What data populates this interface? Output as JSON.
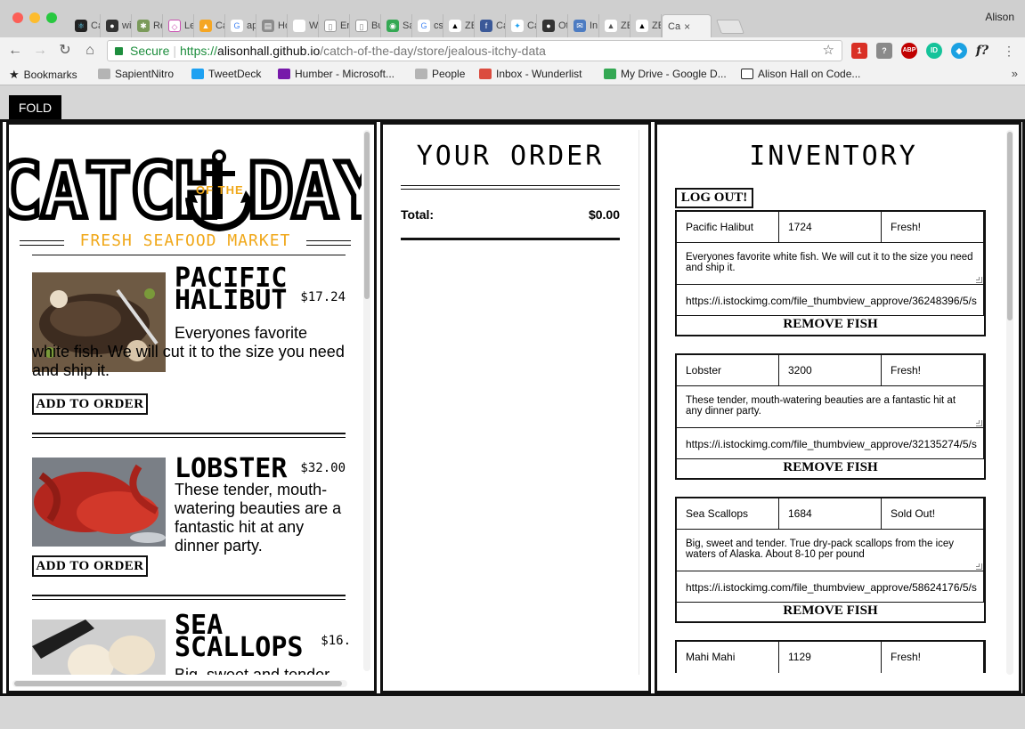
{
  "browser": {
    "profile": "Alison",
    "tabs": [
      {
        "label": "Ca",
        "icon": "react-icon",
        "color": "#222222"
      },
      {
        "label": "wi",
        "icon": "github-icon",
        "color": "#333333"
      },
      {
        "label": "Re",
        "icon": "react-icon",
        "color": "#7a9a5a"
      },
      {
        "label": "Le",
        "icon": "graphql-icon",
        "color": "#c94fb0"
      },
      {
        "label": "Ca",
        "icon": "firebase-icon",
        "color": "#f5a623"
      },
      {
        "label": "ap",
        "icon": "google-icon",
        "color": "#4285f4"
      },
      {
        "label": "Ho",
        "icon": "page-icon",
        "color": "#8c8c8c"
      },
      {
        "label": "W",
        "icon": "apple-icon",
        "color": "#888888"
      },
      {
        "label": "Er",
        "icon": "document-icon",
        "color": "#9a9a9a"
      },
      {
        "label": "Bu",
        "icon": "document-icon",
        "color": "#9a9a9a"
      },
      {
        "label": "Sa",
        "icon": "maps-icon",
        "color": "#34a853"
      },
      {
        "label": "cs",
        "icon": "google-icon",
        "color": "#4285f4"
      },
      {
        "label": "ZE",
        "icon": "zeit-icon",
        "color": "#000000"
      },
      {
        "label": "Ca",
        "icon": "facebook-icon",
        "color": "#3b5998"
      },
      {
        "label": "Ca",
        "icon": "twitter-icon",
        "color": "#1da1f2"
      },
      {
        "label": "Ot",
        "icon": "github-icon",
        "color": "#333333"
      },
      {
        "label": "In",
        "icon": "inbox-icon",
        "color": "#4d7cc2"
      },
      {
        "label": "ZE",
        "icon": "zeit-icon",
        "color": "#555555"
      },
      {
        "label": "ZE",
        "icon": "zeit-icon",
        "color": "#000000"
      }
    ],
    "active_tab": {
      "label": "Ca",
      "close": "×"
    },
    "url": {
      "secure_label": "Secure",
      "separator": "|",
      "scheme": "https://",
      "host": "alisonhall.github.io",
      "path": "/catch-of-the-day/store/jealous-itchy-data"
    },
    "extensions": [
      {
        "name": "gmail-extension-icon",
        "label": "1",
        "color": "#d93025"
      },
      {
        "name": "unknown-extension-icon",
        "label": "?",
        "color": "#8a8a8a"
      },
      {
        "name": "adblock-plus-icon",
        "label": "ABP",
        "color": "#c00000"
      },
      {
        "name": "grammarly-icon",
        "label": "ID",
        "color": "#15c39a"
      },
      {
        "name": "extension-icon",
        "label": "◆",
        "color": "#1ba1e2"
      },
      {
        "name": "whatfont-icon",
        "label": "f?",
        "color": "#f2f2f2"
      }
    ],
    "bookmarks": [
      {
        "label": "Bookmarks",
        "icon": "star-icon",
        "color": "#444444"
      },
      {
        "label": "SapientNitro",
        "icon": "folder-icon",
        "color": "#b4b4b4"
      },
      {
        "label": "TweetDeck",
        "icon": "tweetdeck-icon",
        "color": "#1da1f2"
      },
      {
        "label": "Humber - Microsoft...",
        "icon": "onenote-icon",
        "color": "#7719aa"
      },
      {
        "label": "People",
        "icon": "folder-icon",
        "color": "#b4b4b4"
      },
      {
        "label": "Inbox - Wunderlist",
        "icon": "wunderlist-icon",
        "color": "#db4c3f"
      },
      {
        "label": "My Drive - Google D...",
        "icon": "google-drive-icon",
        "color": "#34a853"
      },
      {
        "label": "Alison Hall on Code...",
        "icon": "codepen-icon",
        "color": "#222222"
      }
    ],
    "bookmarks_more": "»"
  },
  "page": {
    "fold_button": "FOLD",
    "logo": {
      "left": "CATCH",
      "middle": "OF THE",
      "right": "DAY",
      "tagline": "FRESH SEAFOOD MARKET"
    },
    "menu": [
      {
        "name": "PACIFIC HALIBUT",
        "price": "$17.24",
        "desc": "Everyones favorite white fish. We will cut it to the size you need and ship it.",
        "button": "ADD TO ORDER"
      },
      {
        "name": "LOBSTER",
        "price": "$32.00",
        "desc": "These tender, mouth-watering beauties are a fantastic hit at any dinner party.",
        "button": "ADD TO ORDER"
      },
      {
        "name": "SEA SCALLOPS",
        "price": "$16.",
        "desc": "Big, sweet and tender"
      }
    ],
    "order": {
      "title": "YOUR ORDER",
      "total_label": "Total:",
      "total_value": "$0.00"
    },
    "inventory": {
      "title": "INVENTORY",
      "logout": "LOG OUT!",
      "remove_label": "REMOVE FISH",
      "items": [
        {
          "name": "Pacific Halibut",
          "price": "1724",
          "status": "Fresh!",
          "desc": "Everyones favorite white fish. We will cut it to the size you need and ship it.",
          "image": "https://i.istockimg.com/file_thumbview_approve/36248396/5/s"
        },
        {
          "name": "Lobster",
          "price": "3200",
          "status": "Fresh!",
          "desc": "These tender, mouth-watering beauties are a fantastic hit at any dinner party.",
          "image": "https://i.istockimg.com/file_thumbview_approve/32135274/5/s"
        },
        {
          "name": "Sea Scallops",
          "price": "1684",
          "status": "Sold Out!",
          "desc": "Big, sweet and tender. True dry-pack scallops from the icey waters of Alaska. About 8-10 per pound",
          "image": "https://i.istockimg.com/file_thumbview_approve/58624176/5/s"
        },
        {
          "name": "Mahi Mahi",
          "price": "1129",
          "status": "Fresh!"
        }
      ]
    }
  }
}
